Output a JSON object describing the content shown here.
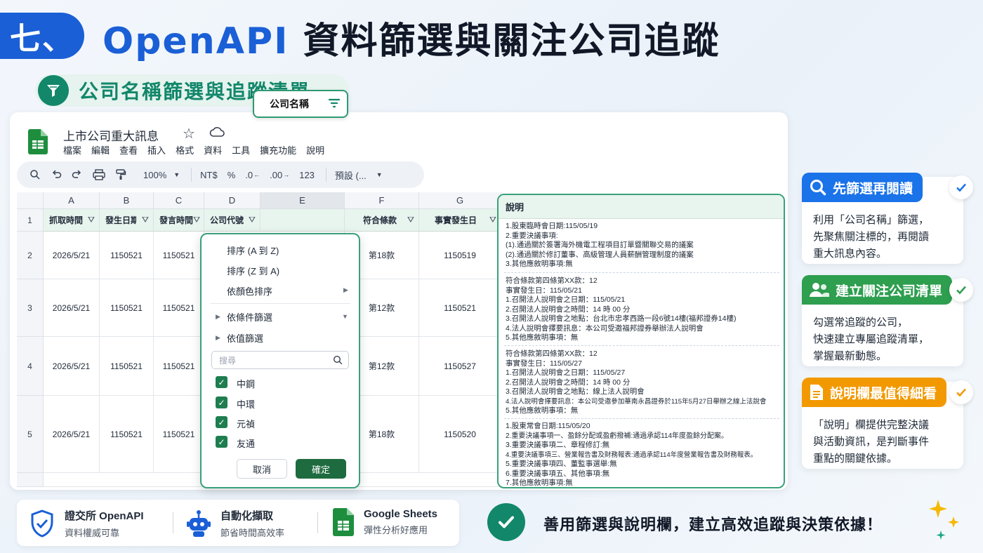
{
  "header": {
    "number": "七、",
    "title_highlight": "OpenAPI",
    "title_rest": "資料篩選與關注公司追蹤",
    "subtitle": "公司名稱篩選與追蹤清單"
  },
  "sheet": {
    "doc_title": "上市公司重大訊息",
    "menu": [
      "檔案",
      "編輯",
      "查看",
      "插入",
      "格式",
      "資料",
      "工具",
      "擴充功能",
      "說明"
    ],
    "toolbar": {
      "zoom": "100%",
      "currency": "NT$",
      "percent": "%",
      "dec_decrease": ".0",
      "dec_increase": ".00",
      "number_format": "123",
      "font": "預設 (..."
    },
    "column_letters": [
      "A",
      "B",
      "C",
      "D",
      "E",
      "F",
      "G"
    ],
    "row_numbers": [
      "1",
      "2",
      "3",
      "4",
      "5"
    ],
    "headers": [
      "抓取時間",
      "發生日期",
      "發言時間",
      "公司代號",
      "公司名稱",
      "符合條款",
      "事實發生日"
    ],
    "rows": [
      {
        "a": "2026/5/21",
        "b": "1150521",
        "c": "1150521",
        "f": "第18款",
        "g": "1150519"
      },
      {
        "a": "2026/5/21",
        "b": "1150521",
        "c": "1150521",
        "f": "第12款",
        "g": "1150521"
      },
      {
        "a": "2026/5/21",
        "b": "1150521",
        "c": "1150521",
        "f": "第12款",
        "g": "1150527"
      },
      {
        "a": "2026/5/21",
        "b": "1150521",
        "c": "1150521",
        "f": "第18款",
        "g": "1150520"
      }
    ],
    "filter_column": "公司名稱"
  },
  "dropdown": {
    "sort_az": "排序 (A 到 Z)",
    "sort_za": "排序 (Z 到 A)",
    "sort_color": "依顏色排序",
    "filter_condition": "依條件篩選",
    "filter_value": "依值篩選",
    "search_placeholder": "搜尋",
    "options": [
      "中鋼",
      "中環",
      "元禎",
      "友通"
    ],
    "cancel": "取消",
    "ok": "確定"
  },
  "explain": {
    "header": "說明",
    "blocks": [
      [
        "1.股東臨時會日期:115/05/19",
        "2.重要決議事項:",
        "(1).通過關於簽署海外機電工程項目訂單暨關聯交易的議案",
        "(2).通過關於修訂董事、高級管理人員薪酬管理制度的議案",
        "3.其他應敘明事項:無"
      ],
      [
        "符合條款第四條第XX款：12",
        "事實發生日：115/05/21",
        "1.召開法人說明會之日期：115/05/21",
        "2.召開法人說明會之時間：14 時 00 分",
        "3.召開法人說明會之地點：台北市忠孝西路一段6號14樓(福邦證券14樓)",
        "4.法人說明會擇要訊息：本公司受邀福邦證券舉辦法人說明會",
        "5.其他應敘明事項：無"
      ],
      [
        "符合條款第四條第XX款：12",
        "事實發生日：115/05/27",
        "1.召開法人說明會之日期：115/05/27",
        "2.召開法人說明會之時間：14 時 00 分",
        "3.召開法人說明會之地點：線上法人說明會",
        "4.法人說明會擇要訊息：本公司受邀參加華南永昌證券於115年5月27日舉辦之線上法說會",
        "5.其他應敘明事項：無"
      ],
      [
        "1.股東常會日期:115/05/20",
        "2.重要決議事項一、盈餘分配或盈虧撥補:通過承認114年度盈餘分配案。",
        "3.重要決議事項二、章程修訂:無",
        "4.重要決議事項三、營業報告書及財務報表:通過承認114年度營業報告書及財務報表。",
        "5.重要決議事項四、董監事選舉:無",
        "6.重要決議事項五、其他事項:無",
        "7.其他應敘明事項:無"
      ]
    ]
  },
  "cards": [
    {
      "title": "先篩選再閱讀",
      "lines": [
        "利用「公司名稱」篩選，",
        "先聚焦關注標的，再閱讀",
        "重大訊息內容。"
      ],
      "color": "#1a73e8"
    },
    {
      "title": "建立關注公司清單",
      "lines": [
        "勾選常追蹤的公司，",
        "快速建立專屬追蹤清單，",
        "掌握最新動態。"
      ],
      "color": "#2e9e4f"
    },
    {
      "title": "說明欄最值得細看",
      "lines": [
        "「說明」欄提供完整決議",
        "與活動資訊，是判斷事件",
        "重點的關鍵依據。"
      ],
      "color": "#f29900"
    }
  ],
  "footer": {
    "items": [
      {
        "title": "證交所 OpenAPI",
        "desc": "資料權威可靠"
      },
      {
        "title": "自動化擷取",
        "desc": "節省時間高效率"
      },
      {
        "title": "Google Sheets",
        "desc": "彈性分析好應用"
      }
    ],
    "message": "善用篩選與說明欄，建立高效追蹤與決策依據！"
  },
  "colors": {
    "brand_blue": "#1a5fd6",
    "brand_green": "#12876a",
    "sheet_green": "#1e7e4f",
    "accent_orange": "#f29900"
  }
}
